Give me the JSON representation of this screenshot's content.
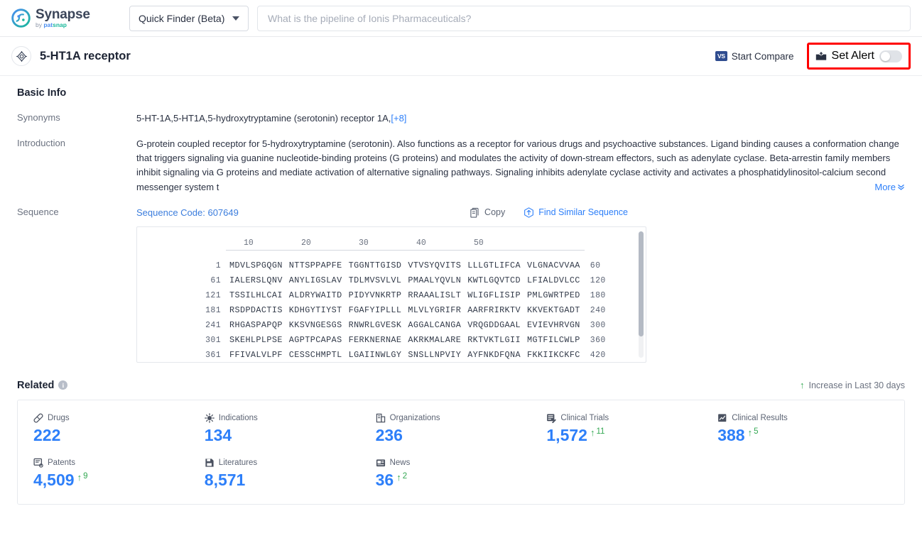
{
  "brand": {
    "name": "Synapse",
    "by": "by ",
    "by_brand": "pat",
    "by_brand2": "snap"
  },
  "topbar": {
    "finder_label": "Quick Finder (Beta)",
    "search_placeholder": "What is the pipeline of Ionis Pharmaceuticals?",
    "search_value": ""
  },
  "subheader": {
    "entity_title": "5-HT1A receptor",
    "target_icon": "target-icon",
    "start_compare": "Start Compare",
    "vs_badge": "VS",
    "set_alert": "Set Alert",
    "alert_toggle_state": "off",
    "highlight_color": "#ff0000"
  },
  "basic_info": {
    "section_title": "Basic Info",
    "synonyms_label": "Synonyms",
    "synonyms_value": "5-HT-1A,5-HT1A,5-hydroxytryptamine (serotonin) receptor 1A,",
    "synonyms_more": "[+8]",
    "introduction_label": "Introduction",
    "introduction_text": "G-protein coupled receptor for 5-hydroxytryptamine (serotonin). Also functions as a receptor for various drugs and psychoactive substances. Ligand binding causes a conformation change that triggers signaling via guanine nucleotide-binding proteins (G proteins) and modulates the activity of down-stream effectors, such as adenylate cyclase. Beta-arrestin family members inhibit signaling via G proteins and mediate activation of alternative signaling pathways. Signaling inhibits adenylate cyclase activity and activates a phosphatidylinositol-calcium second messenger system t",
    "more_label": "More",
    "more_chevron": "»"
  },
  "sequence": {
    "label": "Sequence",
    "code_label": "Sequence Code: 607649",
    "copy_label": "Copy",
    "find_similar_label": "Find Similar Sequence",
    "ruler_ticks": [
      "10",
      "20",
      "30",
      "40",
      "50"
    ],
    "rows": [
      {
        "start": "1",
        "chunks": [
          "MDVLSPGQGN",
          "NTTSPPAPFE",
          "TGGNTTGISD",
          "VTVSYQVITS",
          "LLLGTLIFCA",
          "VLGNACVVAA"
        ],
        "end": "60"
      },
      {
        "start": "61",
        "chunks": [
          "IALERSLQNV",
          "ANYLIGSLAV",
          "TDLMVSVLVL",
          "PMAALYQVLN",
          "KWTLGQVTCD",
          "LFIALDVLCC"
        ],
        "end": "120"
      },
      {
        "start": "121",
        "chunks": [
          "TSSILHLCAI",
          "ALDRYWAITD",
          "PIDYVNKRTP",
          "RRAAALISLT",
          "WLIGFLISIP",
          "PMLGWRTPED"
        ],
        "end": "180"
      },
      {
        "start": "181",
        "chunks": [
          "RSDPDACTIS",
          "KDHGYTIYST",
          "FGAFYIPLLL",
          "MLVLYGRIFR",
          "AARFRIRKTV",
          "KKVEKTGADT"
        ],
        "end": "240"
      },
      {
        "start": "241",
        "chunks": [
          "RHGASPAPQP",
          "KKSVNGESGS",
          "RNWRLGVESK",
          "AGGALCANGA",
          "VRQGDDGAAL",
          "EVIEVHRVGN"
        ],
        "end": "300"
      },
      {
        "start": "301",
        "chunks": [
          "SKEHLPLPSE",
          "AGPTPCAPAS",
          "FERKNERNAE",
          "AKRKMALARE",
          "RKTVKTLGII",
          "MGTFILCWLP"
        ],
        "end": "360"
      },
      {
        "start": "361",
        "chunks": [
          "FFIVALVLPF",
          "CESSCHMPTL",
          "LGAIINWLGY",
          "SNSLLNPVIY",
          "AYFNKDFQNA",
          "FKKIIKCKFC"
        ],
        "end": "420"
      }
    ]
  },
  "related": {
    "title": "Related",
    "info_glyph": "i",
    "increase_note": "Increase in Last 30 days",
    "increase_arrow": "↑",
    "stats": [
      {
        "label": "Drugs",
        "icon": "pill-icon",
        "value": "222",
        "delta": ""
      },
      {
        "label": "Indications",
        "icon": "virus-icon",
        "value": "134",
        "delta": ""
      },
      {
        "label": "Organizations",
        "icon": "building-icon",
        "value": "236",
        "delta": ""
      },
      {
        "label": "Clinical Trials",
        "icon": "clinical-trial-icon",
        "value": "1,572",
        "delta": "11"
      },
      {
        "label": "Clinical Results",
        "icon": "clinical-result-icon",
        "value": "388",
        "delta": "5"
      },
      {
        "label": "Patents",
        "icon": "patent-icon",
        "value": "4,509",
        "delta": "9"
      },
      {
        "label": "Literatures",
        "icon": "literature-icon",
        "value": "8,571",
        "delta": ""
      },
      {
        "label": "News",
        "icon": "news-icon",
        "value": "36",
        "delta": "2"
      }
    ]
  },
  "colors": {
    "accent_blue": "#2d7ff9",
    "link_blue": "#3b7ddd",
    "green": "#34a853",
    "highlight_red": "#ff0000",
    "logo_green": "#19b89b",
    "logo_blue": "#4a8ef0"
  }
}
